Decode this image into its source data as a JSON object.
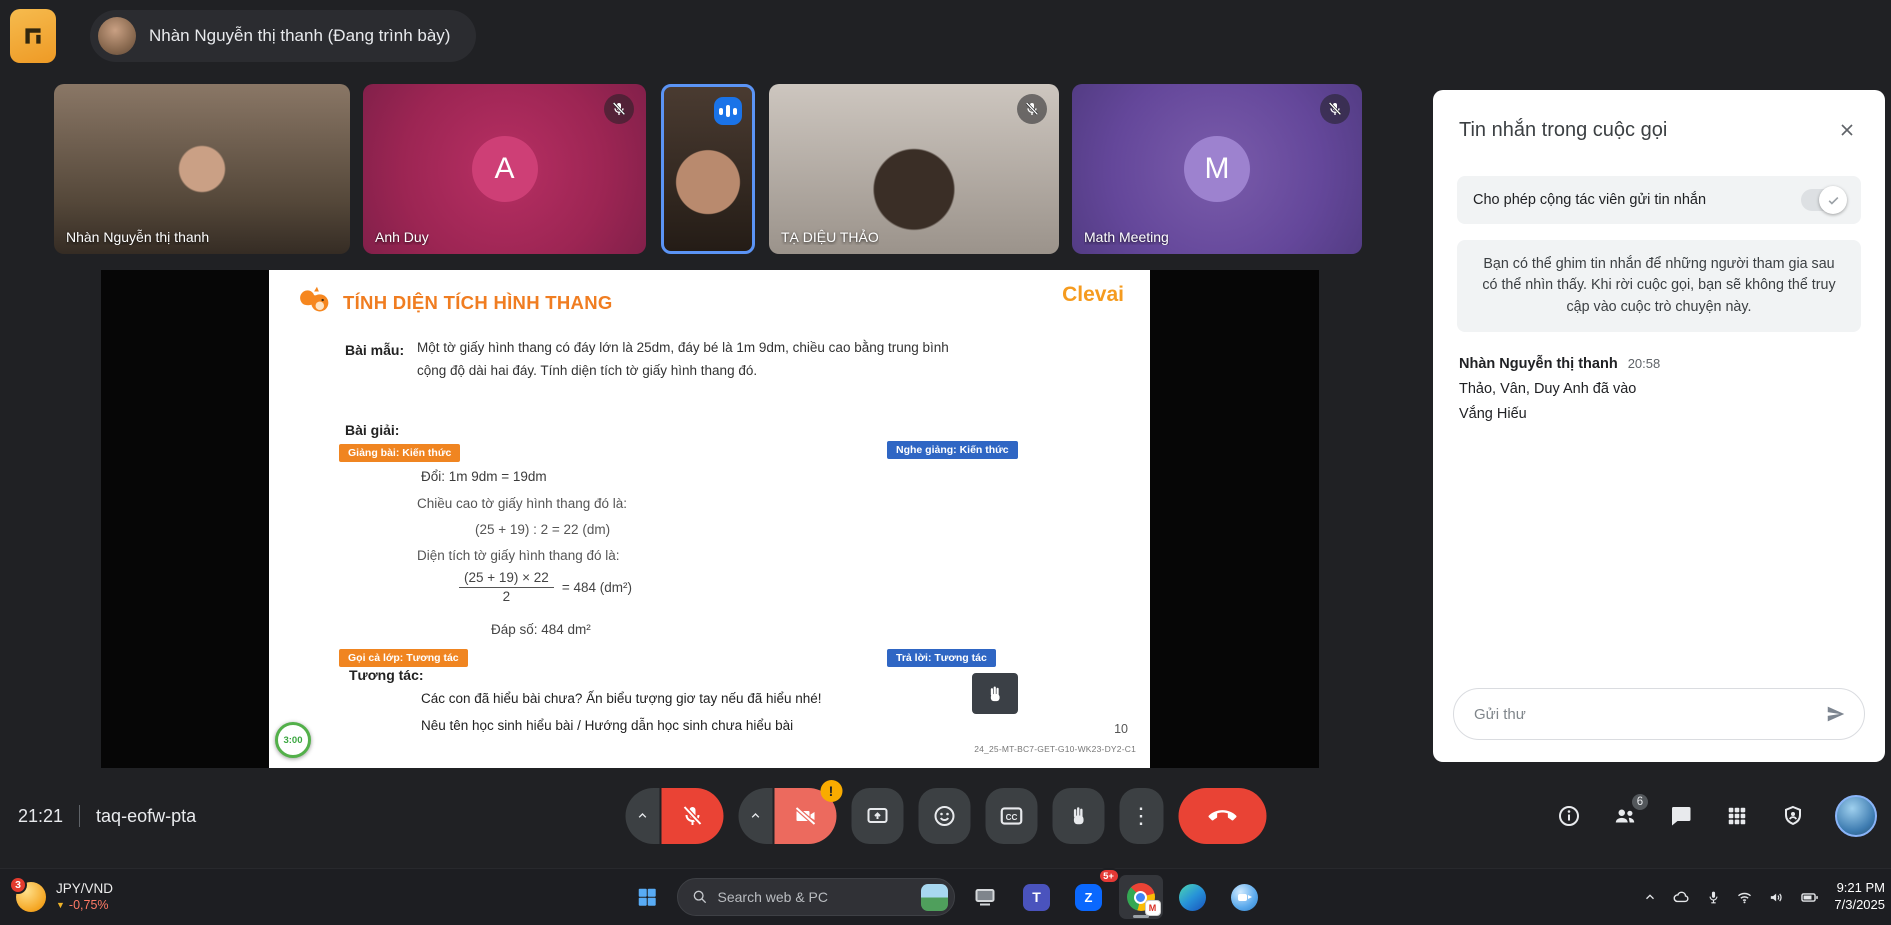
{
  "top_bar": {
    "presenter": "Nhàn Nguyễn thị thanh (Đang trình bày)"
  },
  "tiles": [
    {
      "name": "Nhàn Nguyễn thị thanh"
    },
    {
      "name": "Anh Duy",
      "initial": "A"
    },
    {
      "name": ""
    },
    {
      "name": "TẠ DIỆU THẢO"
    },
    {
      "name": "Math Meeting",
      "initial": "M"
    }
  ],
  "slide": {
    "brand": "Clevai",
    "title": "TÍNH DIỆN TÍCH HÌNH THANG",
    "bai_mau_label": "Bài mẫu:",
    "bai_mau_text": "Một tờ giấy hình thang có đáy lớn là 25dm, đáy bé là 1m 9dm, chiều cao bằng trung bình cộng độ dài hai đáy. Tính diện tích tờ giấy hình thang đó.",
    "bai_giai_label": "Bài giải:",
    "tag_giang_bai": "Giảng bài: Kiến thức",
    "tag_nghe_giang": "Nghe giảng: Kiến thức",
    "doi_line": "Đổi: 1m 9dm = 19dm",
    "chieu_cao_line": "Chiều cao tờ giấy hình thang đó là:",
    "chieu_cao_calc": "(25 + 19) : 2 = 22 (dm)",
    "dien_tich_line": "Diện tích tờ giấy hình thang đó là:",
    "frac_numerator": "(25 + 19) × 22",
    "frac_denominator": "2",
    "frac_result": "= 484 (dm²)",
    "dap_so": "Đáp số: 484 dm²",
    "tag_goi_ca_lop": "Gọi cả lớp: Tương tác",
    "tag_tra_loi": "Trả lời: Tương tác",
    "tuong_tac_label": "Tương tác:",
    "tuong_tac_line1": "Các con đã hiểu bài chưa? Ấn biểu tượng giơ tay nếu đã hiểu nhé!",
    "tuong_tac_line2": "Nêu tên học sinh hiểu bài / Hướng dẫn học sinh chưa hiểu bài",
    "page_number": "10",
    "footer_code": "24_25-MT-BC7-GET-G10-WK23-DY2-C1",
    "timer": "3:00"
  },
  "chat": {
    "title": "Tin nhắn trong cuộc gọi",
    "toggle_label": "Cho phép cộng tác viên gửi tin nhắn",
    "pin_info": "Bạn có thể ghim tin nhắn để những người tham gia sau có thể nhìn thấy. Khi rời cuộc gọi, bạn sẽ không thể truy cập vào cuộc trò chuyện này.",
    "sender": "Nhàn Nguyễn thị thanh",
    "time": "20:58",
    "message_line1": "Thảo, Vân, Duy Anh đã vào",
    "message_line2": "Vắng Hiếu",
    "input_placeholder": "Gửi thư"
  },
  "call_bar": {
    "time": "21:21",
    "code": "taq-eofw-pta",
    "participants": "6",
    "warning": "!",
    "more": "⋮"
  },
  "icons": {
    "cc": "CC",
    "teams": "T",
    "zalo": "Z",
    "chrome_badge": "M"
  },
  "taskbar": {
    "widget_badge": "3",
    "widget_symbol": "JPY/VND",
    "widget_change": "-0,75%",
    "widget_arrow": "▼",
    "search_placeholder": "Search web & PC",
    "zalo_badge": "5+",
    "clock_time": "9:21 PM",
    "clock_date": "7/3/2025"
  },
  "colors": {
    "accent_blue": "#1a73e8",
    "danger_red": "#ea4335",
    "slide_orange": "#f08521",
    "tag_blue": "#2f66c4",
    "brand_orange": "#f59b1f"
  }
}
